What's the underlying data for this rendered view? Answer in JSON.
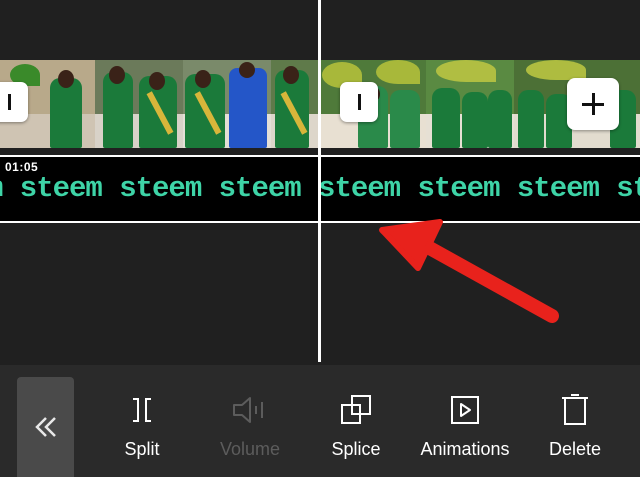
{
  "timeline": {
    "timestamp": "01:05",
    "text_track": {
      "content": "m steem steem steem steem steem steem steem steem",
      "color": "#3ed4a7"
    },
    "playhead_color": "#ffffff",
    "annotation_arrow_color": "#e8221c"
  },
  "toolbar": {
    "back_icon": "double-chevron-left-icon",
    "tools": [
      {
        "label": "Split",
        "icon": "split-icon",
        "enabled": true
      },
      {
        "label": "Volume",
        "icon": "volume-icon",
        "enabled": false
      },
      {
        "label": "Splice",
        "icon": "splice-icon",
        "enabled": true
      },
      {
        "label": "Animations",
        "icon": "animations-icon",
        "enabled": true
      },
      {
        "label": "Delete",
        "icon": "delete-icon",
        "enabled": true
      }
    ]
  },
  "colors": {
    "background": "#202020",
    "toolbar_background": "#2a2a2a",
    "text_track_background": "#000000",
    "disabled_label": "#5c5c5c"
  }
}
